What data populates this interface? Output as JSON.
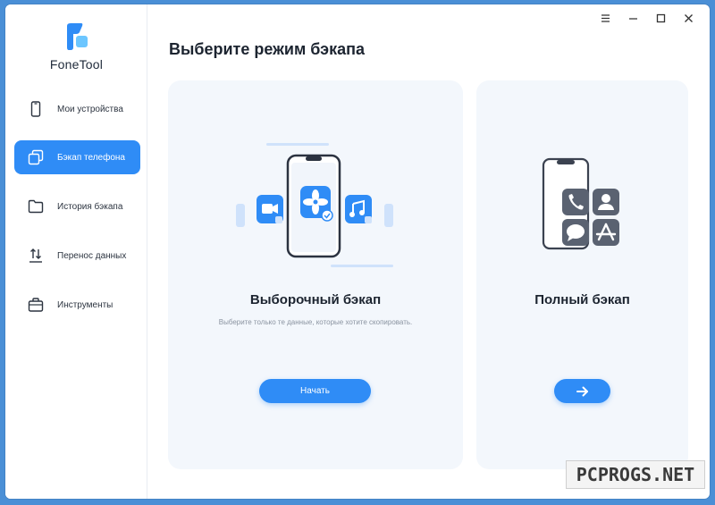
{
  "app": {
    "name": "FoneTool"
  },
  "window_controls": [
    {
      "name": "menu-icon"
    },
    {
      "name": "minimize-icon"
    },
    {
      "name": "maximize-icon"
    },
    {
      "name": "close-icon"
    }
  ],
  "sidebar": {
    "items": [
      {
        "label": "Мои устройства",
        "icon": "phone-icon",
        "active": false
      },
      {
        "label": "Бэкап телефона",
        "icon": "backup-icon",
        "active": true
      },
      {
        "label": "История бэкапа",
        "icon": "folder-icon",
        "active": false
      },
      {
        "label": "Перенос данных",
        "icon": "transfer-icon",
        "active": false
      },
      {
        "label": "Инструменты",
        "icon": "toolbox-icon",
        "active": false
      }
    ]
  },
  "main": {
    "title": "Выберите режим бэкапа",
    "cards": {
      "selective": {
        "title": "Выборочный бэкап",
        "description": "Выберите только те данные, которые хотите скопировать.",
        "button_label": "Начать"
      },
      "full": {
        "title": "Полный бэкап",
        "button_icon": "arrow-right-icon"
      }
    }
  },
  "watermark": {
    "text": "PCPROGS.NET"
  },
  "colors": {
    "accent": "#2f8cf6",
    "card_bg": "#f3f7fc",
    "desktop_bg": "#4a8fd6",
    "icon_dark": "#3b4250"
  }
}
